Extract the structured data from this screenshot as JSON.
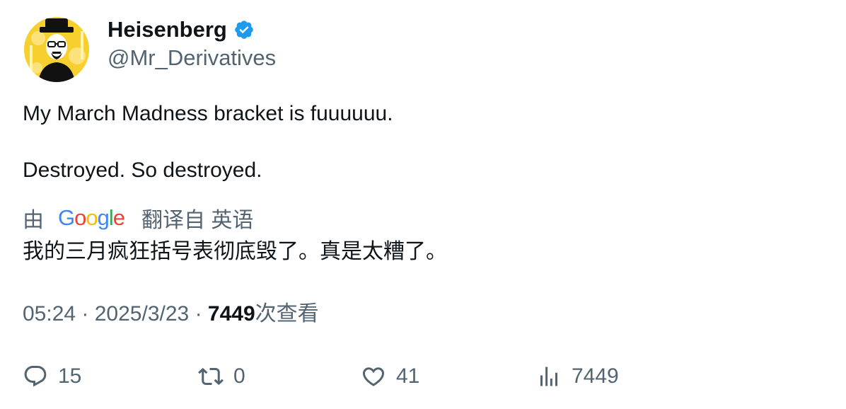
{
  "author": {
    "display_name": "Heisenberg",
    "handle": "@Mr_Derivatives",
    "verified": true,
    "avatar_icon": "heisenberg-avatar"
  },
  "tweet": {
    "lines": [
      "My March Madness bracket is fuuuuuu.",
      "Destroyed. So destroyed."
    ]
  },
  "translation": {
    "prefix": "由",
    "provider_logo": "google-logo",
    "suffix": "翻译自 英语",
    "text": "我的三月疯狂括号表彻底毁了。真是太糟了。"
  },
  "meta": {
    "time": "05:24",
    "separator": "·",
    "date": "2025/3/23",
    "views": "7449",
    "views_label": "次查看"
  },
  "actions": {
    "reply_count": "15",
    "retweet_count": "0",
    "like_count": "41",
    "views_count": "7449"
  },
  "colors": {
    "text_primary": "#0f1419",
    "text_secondary": "#536471",
    "verified_blue": "#1d9bf0",
    "avatar_yellow": "#f7cf2e"
  }
}
